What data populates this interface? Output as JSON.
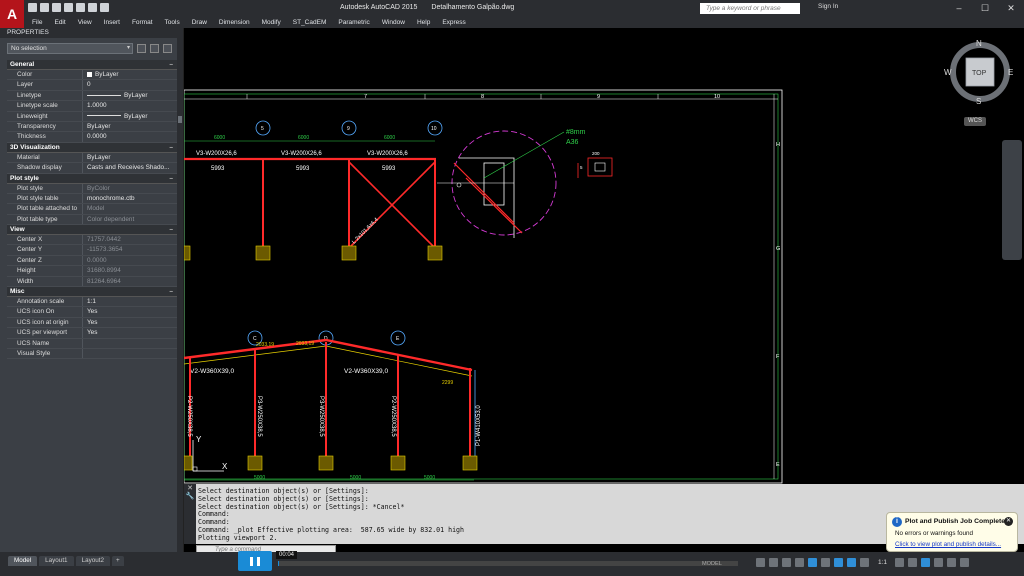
{
  "window": {
    "app_title": "Autodesk AutoCAD 2015",
    "file_name": "Detalhamento Galpão.dwg",
    "search_placeholder": "Type a keyword or phrase",
    "sign_in": "Sign In"
  },
  "menu": [
    "File",
    "Edit",
    "View",
    "Insert",
    "Format",
    "Tools",
    "Draw",
    "Dimension",
    "Modify",
    "ST_CadEM",
    "Parametric",
    "Window",
    "Help",
    "Express"
  ],
  "properties": {
    "title": "PROPERTIES",
    "selection": "No selection",
    "sections": [
      {
        "name": "General",
        "rows": [
          {
            "k": "Color",
            "v": "ByLayer",
            "swatch": true
          },
          {
            "k": "Layer",
            "v": "0"
          },
          {
            "k": "Linetype",
            "v": "ByLayer",
            "line": true
          },
          {
            "k": "Linetype scale",
            "v": "1.0000"
          },
          {
            "k": "Lineweight",
            "v": "ByLayer",
            "line": true
          },
          {
            "k": "Transparency",
            "v": "ByLayer"
          },
          {
            "k": "Thickness",
            "v": "0.0000"
          }
        ]
      },
      {
        "name": "3D Visualization",
        "rows": [
          {
            "k": "Material",
            "v": "ByLayer"
          },
          {
            "k": "Shadow display",
            "v": "Casts and Receives Shado..."
          }
        ]
      },
      {
        "name": "Plot style",
        "rows": [
          {
            "k": "Plot style",
            "v": "ByColor",
            "dim": true
          },
          {
            "k": "Plot style table",
            "v": "monochrome.ctb"
          },
          {
            "k": "Plot table attached to",
            "v": "Model",
            "dim": true
          },
          {
            "k": "Plot table type",
            "v": "Color dependent",
            "dim": true
          }
        ]
      },
      {
        "name": "View",
        "rows": [
          {
            "k": "Center X",
            "v": "71757.0442",
            "dim": true
          },
          {
            "k": "Center Y",
            "v": "-11573.3654",
            "dim": true
          },
          {
            "k": "Center Z",
            "v": "0.0000",
            "dim": true
          },
          {
            "k": "Height",
            "v": "31680.8994",
            "dim": true
          },
          {
            "k": "Width",
            "v": "81264.6964",
            "dim": true
          }
        ]
      },
      {
        "name": "Misc",
        "rows": [
          {
            "k": "Annotation scale",
            "v": "1:1"
          },
          {
            "k": "UCS icon On",
            "v": "Yes"
          },
          {
            "k": "UCS icon at origin",
            "v": "Yes"
          },
          {
            "k": "UCS per viewport",
            "v": "Yes"
          },
          {
            "k": "UCS Name",
            "v": ""
          },
          {
            "k": "Visual Style",
            "v": ""
          }
        ]
      }
    ]
  },
  "drawing": {
    "grid_numbers": [
      "7",
      "8",
      "9",
      "10"
    ],
    "grid_letters": [
      "H",
      "G",
      "F",
      "E"
    ],
    "bubbles_top": [
      "5",
      "9",
      "10"
    ],
    "bubbles_bottom": [
      "C",
      "D",
      "E"
    ],
    "dims_top": [
      "6000",
      "6000",
      "6000"
    ],
    "beams_top": [
      "V3-W200X26,6",
      "V3-W200X26,6",
      "V3-W200X26,6"
    ],
    "lengths_top": [
      "5993",
      "5993",
      "5993"
    ],
    "brace_label": "L 2x101,6x6,4",
    "callout_1": "#8mm",
    "callout_2": "A36",
    "detail_dim": "200",
    "detail_dim_2": "5",
    "beams_bottom": [
      "V2-W360X39,0",
      "V2-W360X39,0"
    ],
    "small_dims": [
      "2033,19",
      "2033,19",
      "2299"
    ],
    "columns": [
      "P2-W250X38,5",
      "P3-W250X38,5",
      "P3-W250X38,5",
      "P2-W250X38,5",
      "P1-W410X53,0"
    ],
    "dims_bottom": [
      "5000",
      "5000",
      "5000"
    ],
    "ucs_y": "Y",
    "ucs_x": "X"
  },
  "viewcube": {
    "n": "N",
    "s": "S",
    "e": "E",
    "w": "W",
    "face": "TOP",
    "wcs": "WCS"
  },
  "command": {
    "lines": [
      "Select destination object(s) or [Settings]:",
      "Select destination object(s) or [Settings]:",
      "Select destination object(s) or [Settings]: *Cancel*",
      "Command:",
      "Command:",
      "Command: _plot Effective plotting area:  587.65 wide by 832.01 high",
      "Plotting viewport 2."
    ],
    "prompt": "Type a command"
  },
  "tabs": [
    "Model",
    "Layout1",
    "Layout2",
    "+"
  ],
  "status": {
    "model": "MODEL",
    "scale": "1:1"
  },
  "video": {
    "time": "00:04",
    "progress": 0.003
  },
  "notification": {
    "title": "Plot and Publish Job Complete",
    "message": "No errors or warnings found",
    "link": "Click to view plot and publish details..."
  }
}
